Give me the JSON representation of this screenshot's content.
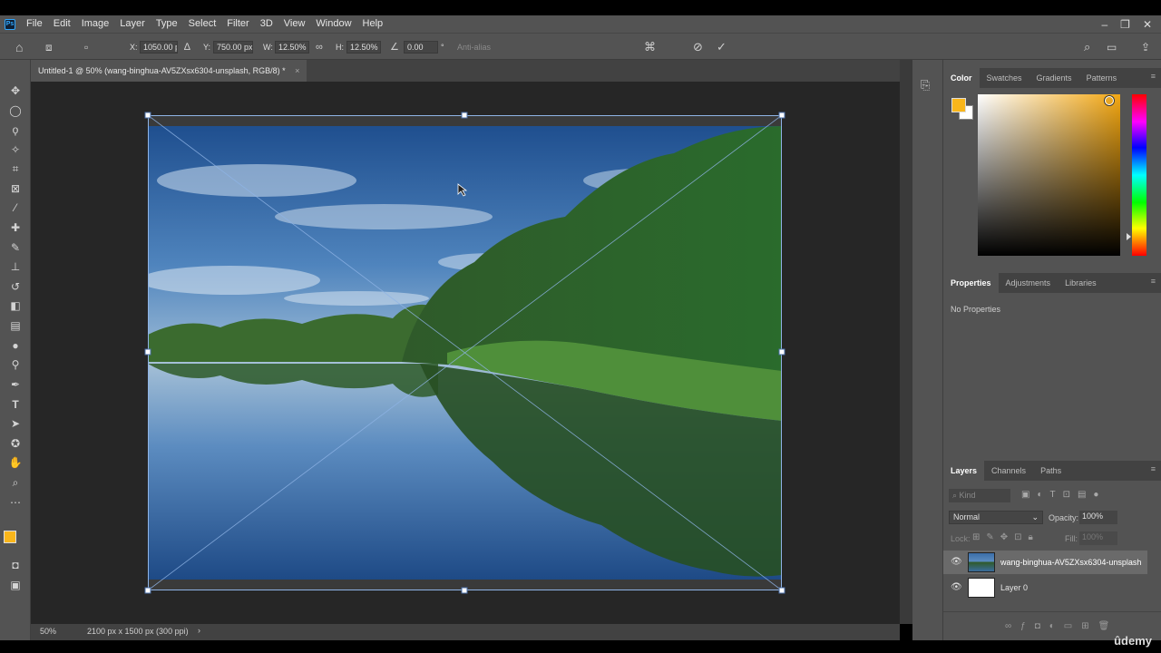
{
  "menubar": {
    "logo": "Ps",
    "items": [
      "File",
      "Edit",
      "Image",
      "Layer",
      "Type",
      "Select",
      "Filter",
      "3D",
      "View",
      "Window",
      "Help"
    ],
    "window_controls": [
      "–",
      "❐",
      "✕"
    ]
  },
  "options": {
    "x_label": "X:",
    "x_value": "1050.00 p",
    "y_label": "Y:",
    "y_value": "750.00 px",
    "w_label": "W:",
    "w_value": "12.50%",
    "h_label": "H:",
    "h_value": "12.50%",
    "angle_value": "0.00",
    "degree_sign": "°",
    "anti_alias": "Anti-alias"
  },
  "document": {
    "tab_title": "Untitled-1 @ 50% (wang-binghua-AV5ZXsx6304-unsplash, RGB/8) *",
    "close": "×"
  },
  "status": {
    "zoom": "50%",
    "doc_size": "2100 px x 1500 px (300 ppi)",
    "arrow": "›"
  },
  "color_panel": {
    "tabs": [
      "Color",
      "Swatches",
      "Gradients",
      "Patterns"
    ],
    "foreground": "#f9b61b",
    "background": "#ffffff"
  },
  "properties_panel": {
    "tabs": [
      "Properties",
      "Adjustments",
      "Libraries"
    ],
    "empty_text": "No Properties"
  },
  "layers_panel": {
    "tabs": [
      "Layers",
      "Channels",
      "Paths"
    ],
    "kind_placeholder": "Kind",
    "blend_mode": "Normal",
    "opacity_label": "Opacity:",
    "opacity_value": "100%",
    "lock_label": "Lock:",
    "fill_label": "Fill:",
    "fill_value": "100%",
    "layers": [
      {
        "name": "wang-binghua-AV5ZXsx6304-unsplash",
        "selected": true
      },
      {
        "name": "Layer 0",
        "selected": false
      }
    ]
  },
  "watermark": "ûdemy"
}
